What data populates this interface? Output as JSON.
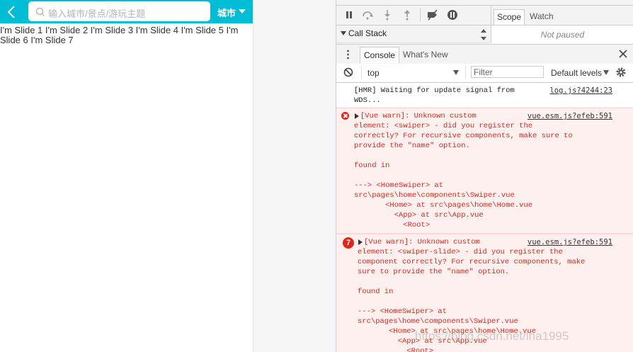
{
  "app": {
    "search_placeholder": "输入城市/景点/游玩主题",
    "city_label": "城市",
    "slides_text": "I'm Slide 1 I'm Slide 2 I'm Slide 3 I'm Slide 4 I'm Slide 5 I'm Slide 6 I'm Slide 7",
    "header_color": "#00bcd4"
  },
  "devtools": {
    "callstack_label": "Call Stack",
    "scope_tabs": [
      "Scope",
      "Watch"
    ],
    "not_paused": "Not paused",
    "drawer_tabs": [
      "Console",
      "What's New"
    ],
    "context": "top",
    "filter_placeholder": "Filter",
    "levels": "Default levels",
    "messages": [
      {
        "type": "info",
        "text": "[HMR] Waiting for update signal from\nWDS...",
        "source": "log.js?4244:23"
      },
      {
        "type": "error",
        "text": "[Vue warn]: Unknown custom\nelement: <swiper> - did you register the\ncorrectly? For recursive components, make sure to\nprovide the \"name\" option.\n\nfound in\n\n---> <HomeSwiper> at\nsrc\\pages\\home\\components\\Swiper.vue\n       <Home> at src\\pages\\home\\Home.vue\n         <App> at src\\App.vue\n           <Root>",
        "source": "vue.esm.js?efeb:591"
      },
      {
        "type": "error",
        "count": "7",
        "text": "[Vue warn]: Unknown custom\nelement: <swiper-slide> - did you register the\ncomponent correctly? For recursive components, make\nsure to provide the \"name\" option.\n\nfound in\n\n---> <HomeSwiper> at\nsrc\\pages\\home\\components\\Swiper.vue\n       <Home> at src\\pages\\home\\Home.vue\n         <App> at src\\App.vue\n           <Root>",
        "source": "vue.esm.js?efeb:591"
      }
    ],
    "error_color": "#e0251b"
  },
  "watermark": "https://blog.csdn.net/lha1995"
}
